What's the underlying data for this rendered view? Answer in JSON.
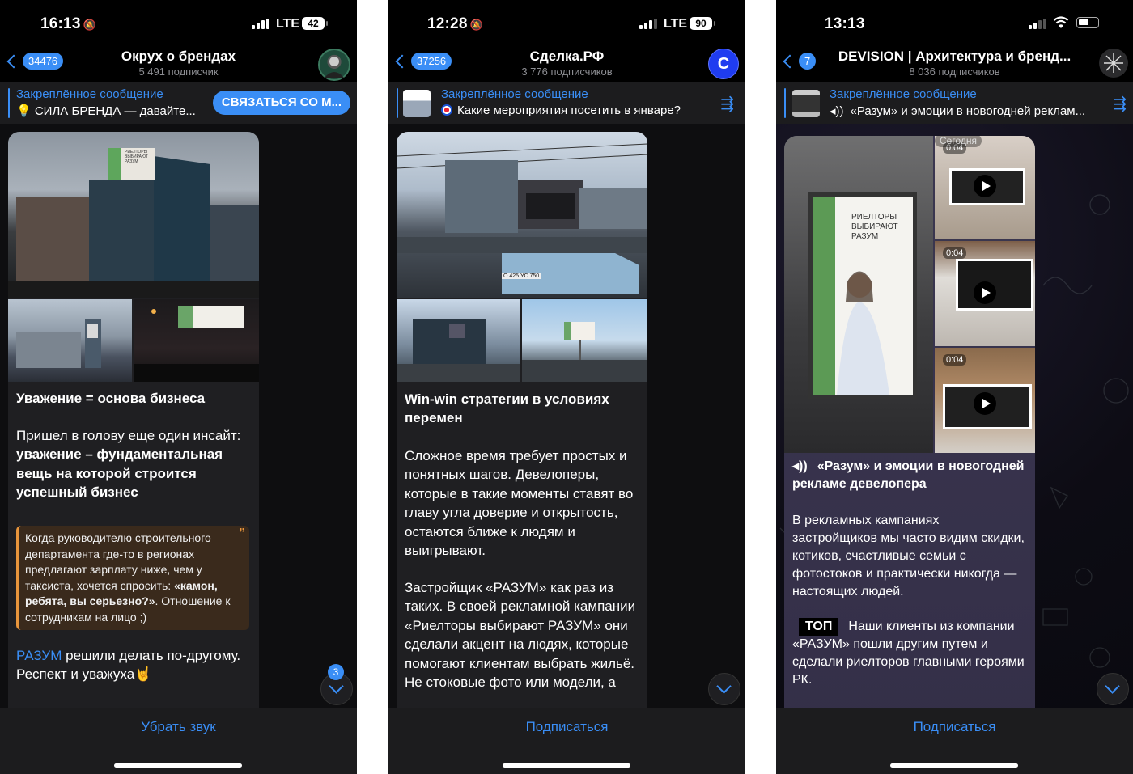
{
  "colors": {
    "accent": "#3a8ef6",
    "quote_accent": "#e8953c",
    "background": "#000000",
    "bubble": "#1f1f22"
  },
  "phone1": {
    "status": {
      "time": "16:13",
      "network": "LTE",
      "battery": "42"
    },
    "header": {
      "back_count": "34476",
      "title": "Окрух о брендах",
      "subtitle": "5 491 подписчик",
      "avatar_icon": "person-avatar"
    },
    "pinned": {
      "label": "Закреплённое сообщение",
      "text": "💡 СИЛА БРЕНДА — давайте...",
      "action_button": "СВЯЗАТЬСЯ СО М..."
    },
    "post": {
      "title": "Уважение = основа бизнеса",
      "p1_normal": "Пришел в голову еще один инсайт:",
      "p1_bold": "уважение – фундаментальная вещь на которой строится успешный бизнес",
      "quote_normal": "Когда руководителю строительного департамента где-то в регионах предлагают зарплату ниже, чем у таксиста, хочется спросить: ",
      "quote_bold": "«камон, ребята, вы серьезно?»",
      "quote_tail": ". Отношение к сотрудникам на лицо ;)",
      "p3_link": "РАЗУМ",
      "p3_text": " решили делать по-другому. Респект и уважуха🤘",
      "billboard_lines": [
        "РИЕЛТОРЫ",
        "ВЫБИРАЮТ",
        "РАЗУМ"
      ]
    },
    "unread_count": "3",
    "bottom_button": "Убрать звук"
  },
  "phone2": {
    "status": {
      "time": "12:28",
      "network": "LTE",
      "battery": "90"
    },
    "header": {
      "back_count": "37256",
      "title": "Сделка.РФ",
      "subtitle": "3 776 подписчиков",
      "avatar_letter": "C"
    },
    "pinned": {
      "label": "Закреплённое сообщение",
      "text": "Какие мероприятия посетить в январе?"
    },
    "post": {
      "title": "Win-win стратегии в условиях перемен",
      "p1": "Сложное время требует простых и понятных шагов. Девелоперы, которые в такие моменты ставят во главу угла доверие и открытость, остаются ближе к людям и выигрывают.",
      "p2": "Застройщик «РАЗУМ» как раз из таких. В своей рекламной кампании «Риелторы выбирают РАЗУМ» они сделали акцент на людях, которые помогают клиентам выбрать жильё. Не стоковые фото или модели, а",
      "plate": "О 425 УС 750"
    },
    "bottom_button": "Подписаться"
  },
  "phone3": {
    "status": {
      "time": "13:13"
    },
    "header": {
      "back_count": "7",
      "title": "DEVISION | Архитектура и бренд...",
      "subtitle": "8 036 подписчиков"
    },
    "pinned": {
      "label": "Закреплённое сообщение",
      "text": "«Разум» и эмоции в новогодней реклам..."
    },
    "date_badge": "Сегодня",
    "videos": [
      {
        "duration": "0:04"
      },
      {
        "duration": "0:04"
      },
      {
        "duration": "0:04"
      }
    ],
    "poster_lines": [
      "РИЕЛТОРЫ",
      "ВЫБИРАЮТ",
      "РАЗУМ"
    ],
    "post": {
      "title": "«Разум» и эмоции в новогодней рекламе девелопера",
      "p1": "В рекламных кампаниях застройщиков мы часто видим скидки, котиков, счастливые семьи с фотостоков и практически никогда — настоящих людей.",
      "top_tag": "ТОП",
      "p2": "Наши клиенты из компании «РАЗУМ» пошли другим путем и сделали риелторов главными героями РК."
    },
    "bottom_button": "Подписаться"
  }
}
